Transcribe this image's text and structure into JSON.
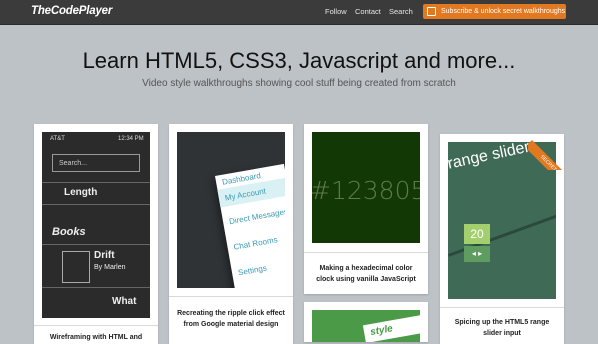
{
  "header": {
    "logo": "TheCodePlayer",
    "nav": [
      "Follow",
      "Contact",
      "Search"
    ],
    "cta": "Subscribe & unlock secret walkthroughs"
  },
  "hero": {
    "title": "Learn HTML5, CSS3, Javascript and more...",
    "subtitle": "Video style walkthroughs showing cool stuff being created from scratch"
  },
  "cards": [
    {
      "caption": "Wireframing with HTML and",
      "thumb": {
        "carrier": "AT&T",
        "time": "12:34 PM",
        "search_placeholder": "Search...",
        "items": [
          "Length",
          "Books",
          "Drift",
          "By Marlen",
          "What"
        ]
      }
    },
    {
      "caption": "Recreating the ripple click effect from Google material design",
      "thumb": {
        "menu_items": [
          "Dashboard",
          "My Account",
          "Direct Messages",
          "Chat Rooms",
          "Settings"
        ]
      }
    },
    {
      "caption": "Making a hexadecimal color clock using vanilla JavaScript",
      "thumb": {
        "text": "#123805",
        "color": "#123805"
      }
    },
    {
      "caption": "Spicing up the HTML5 range slider input",
      "badge": "SECRET",
      "thumb": {
        "title": "range slider",
        "value": "20"
      }
    }
  ],
  "extra": {
    "text": "style"
  },
  "colors": {
    "accent": "#e2781f",
    "topbar": "#3b3b3b",
    "background": "#bdc2c6"
  }
}
